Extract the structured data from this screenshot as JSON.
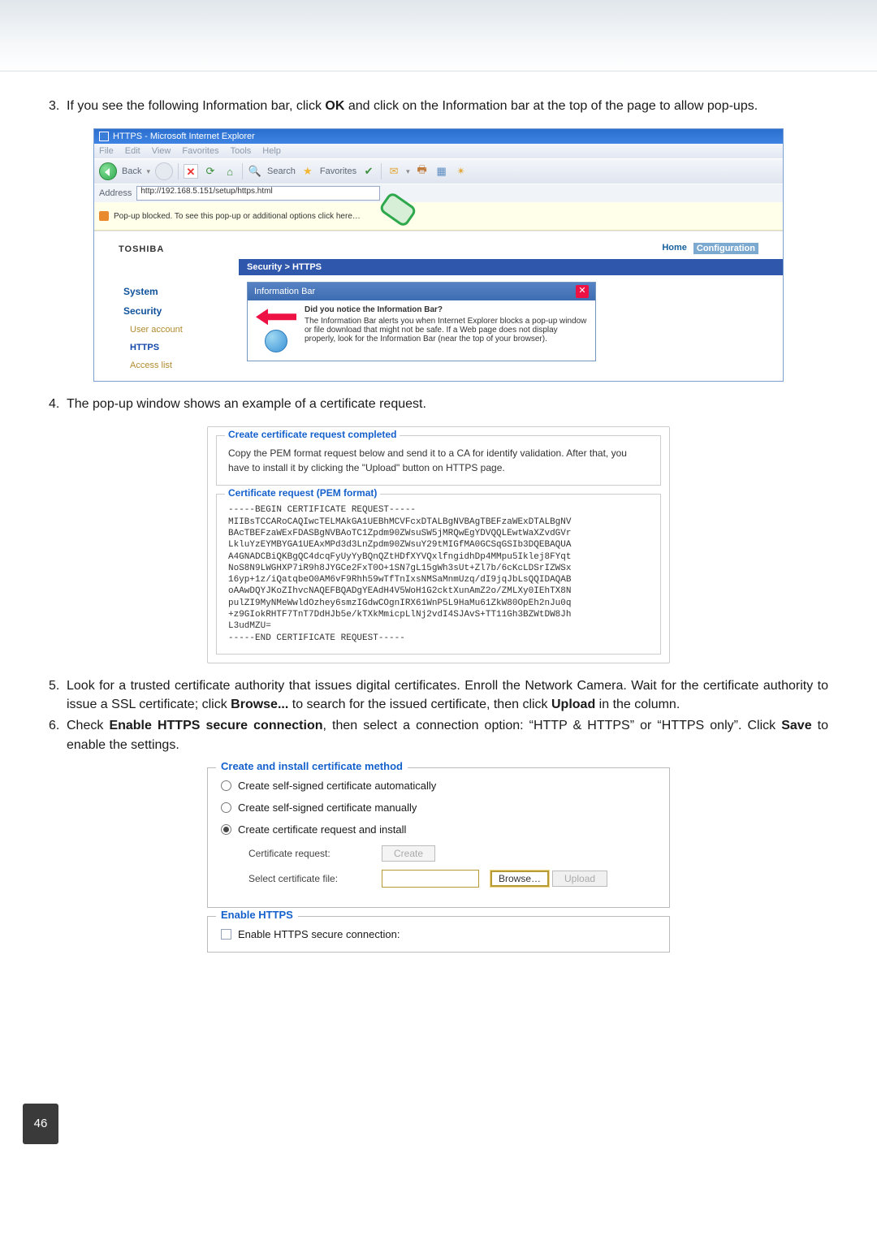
{
  "step3": {
    "num": "3.",
    "text_a": "If you see the following Information bar, click ",
    "bold_ok": "OK",
    "text_b": " and click on the Information bar at the top of the page to allow pop-ups."
  },
  "ie": {
    "title": "HTTPS - Microsoft Internet Explorer",
    "menu": [
      "File",
      "Edit",
      "View",
      "Favorites",
      "Tools",
      "Help"
    ],
    "back": "Back",
    "search": "Search",
    "favorites": "Favorites",
    "address_label": "Address",
    "address_url": "http://192.168.5.151/setup/https.html",
    "popup_bar": "Pop-up blocked. To see this pop-up or additional options click here…",
    "brand": "TOSHIBA",
    "link_home": "Home",
    "link_config": "Configuration",
    "breadcrumb": "Security  >  HTTPS",
    "side_system": "System",
    "side_security": "Security",
    "side_user": "User account",
    "side_https": "HTTPS",
    "side_access": "Access list",
    "dlg_title": "Information Bar",
    "dlg_q": "Did you notice the Information Bar?",
    "dlg_body": "The Information Bar alerts you when Internet Explorer blocks a pop-up window or file download that might not be safe. If a Web page does not display properly, look for the Information Bar (near the top of your browser)."
  },
  "step4": {
    "num": "4.",
    "text": "The pop-up window shows an example of a certificate request."
  },
  "cert": {
    "legend1": "Create certificate request completed",
    "desc": "Copy the PEM format request below and send it to a CA for identify validation. After that, you have to install it by clicking the \"Upload\" button on HTTPS page.",
    "legend2": "Certificate request (PEM format)",
    "pem": "-----BEGIN CERTIFICATE REQUEST-----\nMIIBsTCCARoCAQIwcTELMAkGA1UEBhMCVFcxDTALBgNVBAgTBEFzaWExDTALBgNV\nBAcTBEFzaWExFDASBgNVBAoTC1Zpdm90ZWsuSW5jMRQwEgYDVQQLEwtWaXZvdGVr\nLkluYzEYMBYGA1UEAxMPd3d3LnZpdm90ZWsuY29tMIGfMA0GCSqGSIb3DQEBAQUA\nA4GNADCBiQKBgQC4dcqFyUyYyBQnQZtHDfXYVQxlfngidhDp4MMpu5Iklej8FYqt\nNoS8N9LWGHXP7iR9h8JYGCe2FxT0O+1SN7gL15gWh3sUt+Zl7b/6cKcLDSrIZWSx\n16yp+1z/iQatqbeO0AM6vF9Rhh59wTfTnIxsNMSaMnmUzq/dI9jqJbLsQQIDAQAB\noAAwDQYJKoZIhvcNAQEFBQADgYEAdH4V5WoH1G2cktXunAmZ2o/ZMLXy0IEhTX8N\npulZI9MyNMeWwldOzhey6smzIGdwCOgnIRX61WnP5L9HaMu61ZkW80OpEh2nJu0q\n+z9GIokRHTF7TnT7DdHJb5e/kTXkMmicpLlNj2vdI4SJAvS+TT11Gh3BZWtDW8Jh\nL3udMZU=\n-----END CERTIFICATE REQUEST-----"
  },
  "step5": {
    "num": "5.",
    "text_a": "Look for a trusted certificate authority that issues digital certificates. Enroll the Network Camera. Wait for the certificate authority to issue a SSL certificate; click ",
    "b1": "Browse...",
    "text_b": " to search for the issued certificate, then click ",
    "b2": "Upload",
    "text_c": " in the column."
  },
  "step6": {
    "num": "6.",
    "text_a": "Check ",
    "b1": "Enable HTTPS secure connection",
    "text_b": ", then select a connection option: “HTTP & HTTPS” or “HTTPS only”. Click ",
    "b2": "Save",
    "text_c": " to enable the settings."
  },
  "method": {
    "legend": "Create and install certificate method",
    "opt1": "Create self-signed certificate automatically",
    "opt2": "Create self-signed certificate manually",
    "opt3": "Create certificate request and install",
    "row1_label": "Certificate request:",
    "row1_btn": "Create",
    "row2_label": "Select certificate file:",
    "browse": "Browse…",
    "upload": "Upload"
  },
  "enable": {
    "legend": "Enable HTTPS",
    "label": "Enable HTTPS secure connection:"
  },
  "page_num": "46"
}
